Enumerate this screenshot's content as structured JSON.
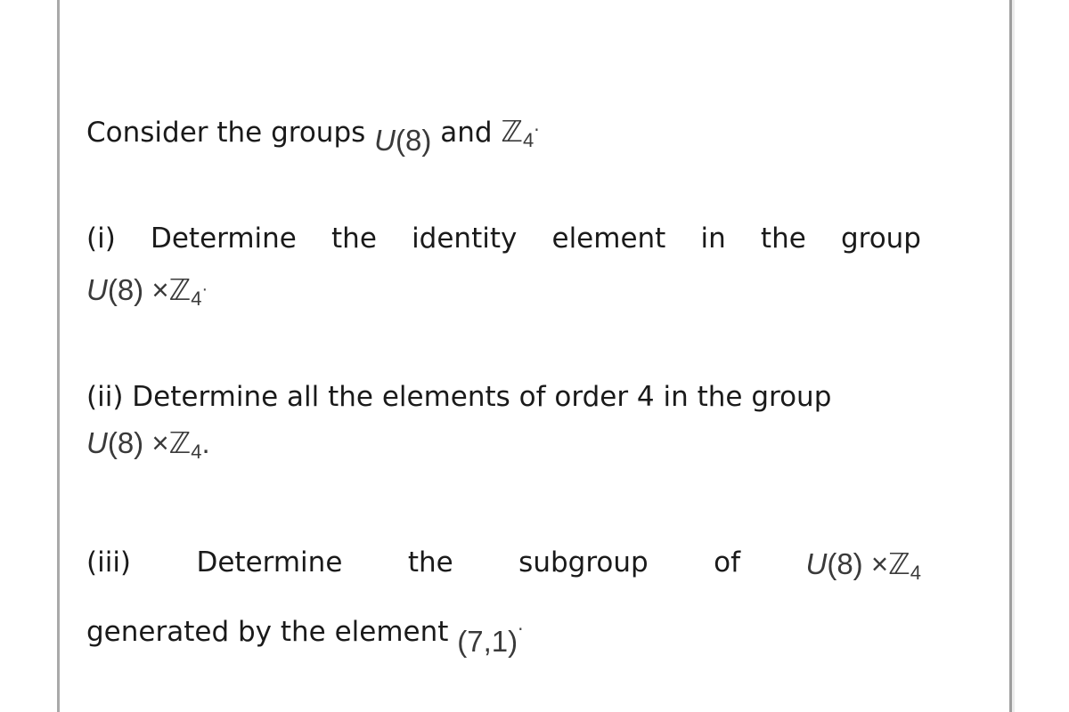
{
  "intro": {
    "text": "Consider the groups",
    "group1": {
      "letter": "U",
      "arg": "(8)"
    },
    "conj": "and",
    "group2": {
      "letter": "ℤ",
      "sub": "4"
    },
    "end": "·"
  },
  "product": {
    "letter_u": "U",
    "arg": "(8)",
    "times": "×",
    "letter_z": "ℤ",
    "sub": "4"
  },
  "questions": [
    {
      "label": "(i)",
      "words": [
        "Determine",
        "the",
        "identity",
        "element",
        "in",
        "the",
        "group"
      ],
      "end": "·"
    },
    {
      "label": "(ii)",
      "text": "Determine all the elements of order 4 in the group",
      "end": "."
    },
    {
      "label": "(iii)",
      "words": [
        "Determine",
        "the",
        "subgroup",
        "of"
      ],
      "continuation": "generated by the element",
      "element": "(7,1)",
      "end": "·"
    }
  ]
}
